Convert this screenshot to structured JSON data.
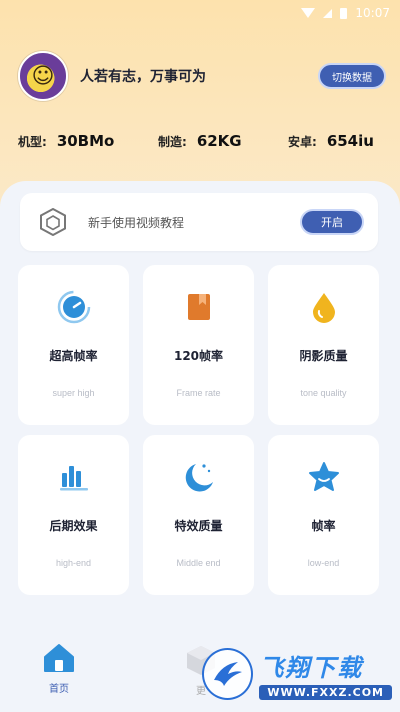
{
  "status_bar": {
    "time": "10:07"
  },
  "profile": {
    "motto": "人若有志，万事可为",
    "switch_label": "切换数据"
  },
  "specs": [
    {
      "label": "机型:",
      "value": "30BMo"
    },
    {
      "label": "制造:",
      "value": "62KG"
    },
    {
      "label": "安卓:",
      "value": "654iu"
    }
  ],
  "tutorial": {
    "label": "新手使用视频教程",
    "button": "开启"
  },
  "cards": [
    {
      "title": "超高帧率",
      "subtitle": "super high",
      "icon": "speedometer-icon"
    },
    {
      "title": "120帧率",
      "subtitle": "Frame rate",
      "icon": "book-icon"
    },
    {
      "title": "阴影质量",
      "subtitle": "tone quality",
      "icon": "droplet-icon"
    },
    {
      "title": "后期效果",
      "subtitle": "high-end",
      "icon": "bar-chart-icon"
    },
    {
      "title": "特效质量",
      "subtitle": "Middle end",
      "icon": "moon-icon"
    },
    {
      "title": "帧率",
      "subtitle": "low-end",
      "icon": "star-icon"
    }
  ],
  "nav": {
    "home": "首页",
    "more": "更"
  },
  "watermark": {
    "title": "飞翔下载",
    "url": "WWW.FXXZ.COM"
  },
  "colors": {
    "accent": "#3f5fb2",
    "icon_blue": "#2e8fd8",
    "icon_orange": "#e07a2c",
    "icon_yellow": "#f0b41e"
  }
}
